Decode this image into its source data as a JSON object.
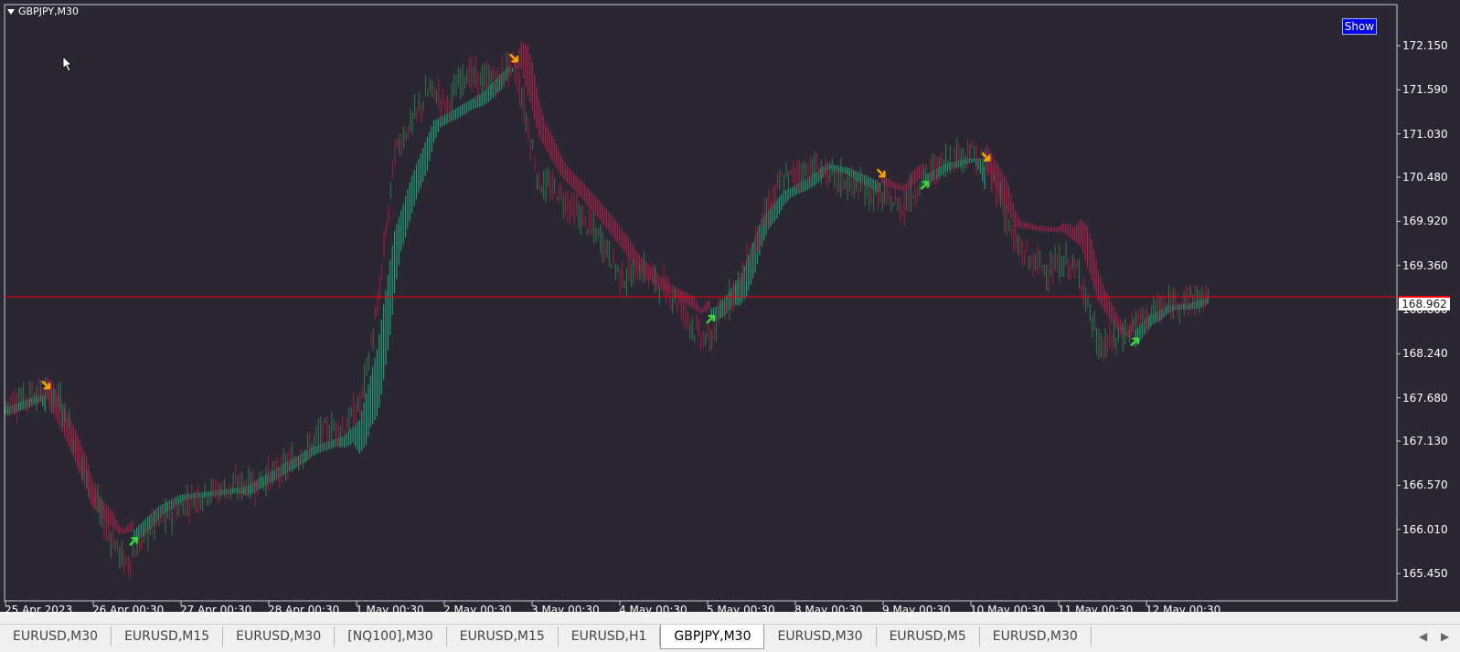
{
  "window": {
    "title": "GBPJPY,M30",
    "show_button": "Show",
    "current_price": "168.962"
  },
  "colors": {
    "background": "#2a2633",
    "bull_band": "#1fa97a",
    "bear_band": "#b0224a",
    "candle_up": "#2f7a4e",
    "candle_down": "#a0203f",
    "buy_arrow": "#3bd43b",
    "sell_arrow": "#f5a300",
    "price_line": "#ff0000",
    "show_button": "#0000ee"
  },
  "price_axis": {
    "labels": [
      "172.150",
      "171.590",
      "171.030",
      "170.480",
      "169.920",
      "169.360",
      "168.800",
      "168.240",
      "167.680",
      "167.130",
      "166.570",
      "166.010",
      "165.450"
    ]
  },
  "time_axis": {
    "labels": [
      "25 Apr 2023",
      "26 Apr 00:30",
      "27 Apr 00:30",
      "28 Apr 00:30",
      "1 May 00:30",
      "2 May 00:30",
      "3 May 00:30",
      "4 May 00:30",
      "5 May 00:30",
      "8 May 00:30",
      "9 May 00:30",
      "10 May 00:30",
      "11 May 00:30",
      "12 May 00:30"
    ]
  },
  "chart_data": {
    "type": "candlestick",
    "symbol": "GBPJPY",
    "timeframe": "M30",
    "ylim": [
      165.45,
      172.45
    ],
    "current_price": 168.962,
    "price_path": [
      [
        0,
        167.6
      ],
      [
        15,
        167.75
      ],
      [
        25,
        167.65
      ],
      [
        35,
        166.8
      ],
      [
        45,
        166.1
      ],
      [
        55,
        165.55
      ],
      [
        65,
        166.0
      ],
      [
        75,
        166.2
      ],
      [
        85,
        166.4
      ],
      [
        95,
        166.5
      ],
      [
        105,
        166.55
      ],
      [
        115,
        166.6
      ],
      [
        125,
        166.75
      ],
      [
        135,
        166.95
      ],
      [
        145,
        167.25
      ],
      [
        155,
        167.3
      ],
      [
        162,
        167.6
      ],
      [
        170,
        168.8
      ],
      [
        178,
        170.8
      ],
      [
        186,
        171.2
      ],
      [
        194,
        171.6
      ],
      [
        202,
        171.4
      ],
      [
        210,
        171.8
      ],
      [
        218,
        171.7
      ],
      [
        226,
        171.75
      ],
      [
        232,
        171.95
      ],
      [
        236,
        171.5
      ],
      [
        244,
        170.4
      ],
      [
        252,
        170.3
      ],
      [
        262,
        170.0
      ],
      [
        272,
        169.7
      ],
      [
        282,
        169.2
      ],
      [
        292,
        169.3
      ],
      [
        300,
        169.1
      ],
      [
        308,
        168.9
      ],
      [
        316,
        168.5
      ],
      [
        322,
        168.4
      ],
      [
        330,
        168.9
      ],
      [
        338,
        169.3
      ],
      [
        346,
        169.9
      ],
      [
        354,
        170.4
      ],
      [
        362,
        170.55
      ],
      [
        370,
        170.6
      ],
      [
        378,
        170.5
      ],
      [
        386,
        170.4
      ],
      [
        394,
        170.3
      ],
      [
        402,
        170.2
      ],
      [
        410,
        170.1
      ],
      [
        418,
        170.4
      ],
      [
        426,
        170.6
      ],
      [
        434,
        170.75
      ],
      [
        442,
        170.8
      ],
      [
        448,
        170.65
      ],
      [
        454,
        170.3
      ],
      [
        462,
        169.6
      ],
      [
        470,
        169.4
      ],
      [
        478,
        169.3
      ],
      [
        486,
        169.4
      ],
      [
        492,
        169.2
      ],
      [
        500,
        168.3
      ],
      [
        506,
        168.4
      ],
      [
        512,
        168.5
      ],
      [
        520,
        168.7
      ],
      [
        528,
        168.8
      ],
      [
        536,
        168.9
      ],
      [
        542,
        168.95
      ],
      [
        550,
        168.92
      ]
    ],
    "band_path": [
      [
        0,
        167.55
      ],
      [
        14,
        167.7
      ],
      [
        18,
        167.72
      ],
      [
        30,
        167.0
      ],
      [
        40,
        166.3
      ],
      [
        52,
        165.95
      ],
      [
        58,
        165.98
      ],
      [
        70,
        166.3
      ],
      [
        80,
        166.45
      ],
      [
        95,
        166.5
      ],
      [
        110,
        166.55
      ],
      [
        125,
        166.8
      ],
      [
        140,
        167.05
      ],
      [
        155,
        167.2
      ],
      [
        162,
        167.4
      ],
      [
        170,
        168.3
      ],
      [
        178,
        169.8
      ],
      [
        186,
        170.5
      ],
      [
        196,
        171.2
      ],
      [
        206,
        171.35
      ],
      [
        218,
        171.55
      ],
      [
        230,
        171.88
      ],
      [
        236,
        171.85
      ],
      [
        244,
        171.0
      ],
      [
        254,
        170.5
      ],
      [
        264,
        170.2
      ],
      [
        276,
        169.8
      ],
      [
        288,
        169.35
      ],
      [
        300,
        169.05
      ],
      [
        310,
        168.9
      ],
      [
        318,
        168.75
      ],
      [
        326,
        168.85
      ],
      [
        336,
        169.2
      ],
      [
        346,
        169.95
      ],
      [
        356,
        170.3
      ],
      [
        366,
        170.45
      ],
      [
        376,
        170.65
      ],
      [
        386,
        170.6
      ],
      [
        394,
        170.5
      ],
      [
        404,
        170.35
      ],
      [
        412,
        170.3
      ],
      [
        420,
        170.5
      ],
      [
        430,
        170.65
      ],
      [
        440,
        170.72
      ],
      [
        446,
        170.72
      ],
      [
        454,
        170.3
      ],
      [
        462,
        169.85
      ],
      [
        472,
        169.8
      ],
      [
        484,
        169.78
      ],
      [
        492,
        169.6
      ],
      [
        500,
        168.9
      ],
      [
        508,
        168.55
      ],
      [
        514,
        168.45
      ],
      [
        522,
        168.7
      ],
      [
        532,
        168.85
      ],
      [
        542,
        168.88
      ],
      [
        550,
        168.95
      ]
    ],
    "trend_segments": [
      {
        "from": 0,
        "to": 18,
        "direction": "up"
      },
      {
        "from": 18,
        "to": 58,
        "direction": "down"
      },
      {
        "from": 58,
        "to": 232,
        "direction": "up"
      },
      {
        "from": 232,
        "to": 322,
        "direction": "down"
      },
      {
        "from": 322,
        "to": 400,
        "direction": "up"
      },
      {
        "from": 400,
        "to": 420,
        "direction": "down"
      },
      {
        "from": 420,
        "to": 448,
        "direction": "up"
      },
      {
        "from": 448,
        "to": 516,
        "direction": "down"
      },
      {
        "from": 516,
        "to": 550,
        "direction": "up"
      }
    ],
    "signals": [
      {
        "bar": 18,
        "type": "sell"
      },
      {
        "bar": 58,
        "type": "buy"
      },
      {
        "bar": 232,
        "type": "sell"
      },
      {
        "bar": 322,
        "type": "buy"
      },
      {
        "bar": 400,
        "type": "sell"
      },
      {
        "bar": 420,
        "type": "buy"
      },
      {
        "bar": 448,
        "type": "sell"
      },
      {
        "bar": 516,
        "type": "buy"
      }
    ]
  },
  "tabs": [
    {
      "label": "EURUSD,M30",
      "active": false
    },
    {
      "label": "EURUSD,M15",
      "active": false
    },
    {
      "label": "EURUSD,M30",
      "active": false
    },
    {
      "label": "[NQ100],M30",
      "active": false
    },
    {
      "label": "EURUSD,M15",
      "active": false
    },
    {
      "label": "EURUSD,H1",
      "active": false
    },
    {
      "label": "GBPJPY,M30",
      "active": true
    },
    {
      "label": "EURUSD,M30",
      "active": false
    },
    {
      "label": "EURUSD,M5",
      "active": false
    },
    {
      "label": "EURUSD,M30",
      "active": false
    }
  ]
}
